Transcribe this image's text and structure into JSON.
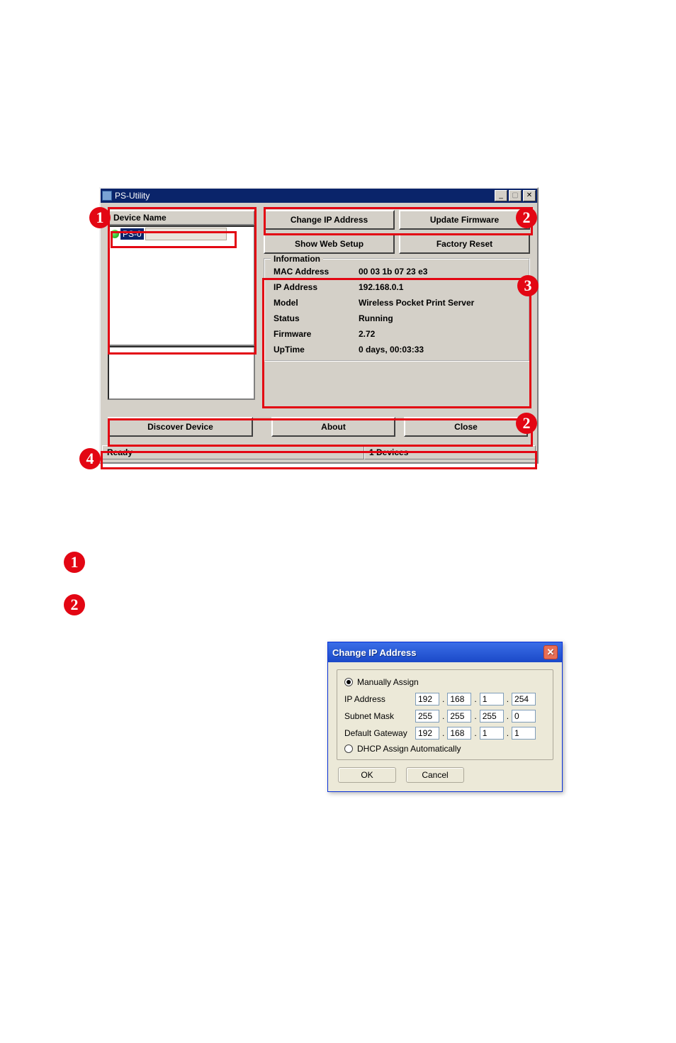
{
  "ps_utility": {
    "title": "PS-Utility",
    "device_header": "Device Name",
    "device_item_name": "PS-0",
    "buttons": {
      "change_ip": "Change IP Address",
      "update_firmware": "Update Firmware",
      "show_web": "Show Web Setup",
      "factory_reset": "Factory Reset",
      "discover": "Discover Device",
      "about": "About",
      "close": "Close"
    },
    "info": {
      "legend": "Information",
      "mac_label": "MAC Address",
      "mac_value": "00 03 1b 07 23 e3",
      "ip_label": "IP Address",
      "ip_value": "192.168.0.1",
      "model_label": "Model",
      "model_value": "Wireless Pocket Print Server",
      "status_label": "Status",
      "status_value": "Running",
      "firmware_label": "Firmware",
      "firmware_value": "2.72",
      "uptime_label": "UpTime",
      "uptime_value": "0 days, 00:03:33"
    },
    "status": {
      "left": "Ready",
      "right": "1 Devices"
    }
  },
  "badges": {
    "b1": "1",
    "b2": "2",
    "b3": "3",
    "b4": "4"
  },
  "change_ip_dialog": {
    "title": "Change IP Address",
    "manual_label": "Manually Assign",
    "ip_label": "IP Address",
    "ip": [
      "192",
      "168",
      "1",
      "254"
    ],
    "subnet_label": "Subnet Mask",
    "subnet": [
      "255",
      "255",
      "255",
      "0"
    ],
    "gw_label": "Default Gateway",
    "gw": [
      "192",
      "168",
      "1",
      "1"
    ],
    "dhcp_label": "DHCP Assign Automatically",
    "ok": "OK",
    "cancel": "Cancel"
  }
}
